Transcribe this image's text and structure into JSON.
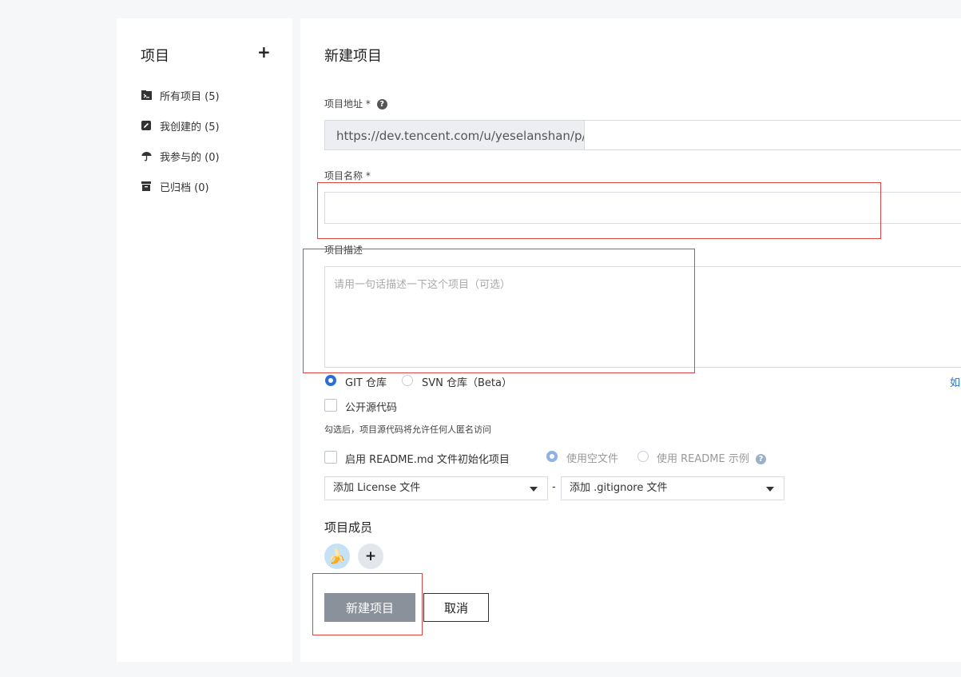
{
  "sidebar": {
    "title": "项目",
    "add_label": "+",
    "items": [
      {
        "label": "所有项目 (5)",
        "icon": "folder-terminal-icon"
      },
      {
        "label": "我创建的 (5)",
        "icon": "edit-icon"
      },
      {
        "label": "我参与的 (0)",
        "icon": "umbrella-icon"
      },
      {
        "label": "已归档 (0)",
        "icon": "archive-icon"
      }
    ]
  },
  "form": {
    "title": "新建项目",
    "address": {
      "label": "项目地址",
      "required": "*",
      "prefix": "https://dev.tencent.com/u/yeselanshan/p/",
      "value": ""
    },
    "name": {
      "label": "项目名称",
      "required": "*",
      "value": ""
    },
    "description": {
      "label": "项目描述",
      "placeholder": "请用一句话描述一下这个项目（可选）"
    },
    "repo_type": {
      "options": [
        "GIT 仓库",
        "SVN 仓库（Beta）"
      ],
      "selected": "GIT 仓库",
      "right_link": "如"
    },
    "open_source": {
      "label": "公开源代码",
      "checked": false,
      "hint": "勾选后，项目源代码将允许任何人匿名访问"
    },
    "readme": {
      "label": "启用 README.md 文件初始化项目",
      "checked": false,
      "options": [
        "使用空文件",
        "使用 README 示例"
      ],
      "selected": "使用空文件"
    },
    "license_select": "添加 License 文件",
    "separator": "-",
    "gitignore_select": "添加 .gitignore 文件",
    "members": {
      "title": "项目成员",
      "avatar_emoji": "🍌",
      "add_label": "+"
    },
    "submit_label": "新建项目",
    "cancel_label": "取消"
  },
  "colors": {
    "accent": "#2a6fd6",
    "annotation_box": "#dd4444",
    "primary_button": "#8b919b"
  }
}
